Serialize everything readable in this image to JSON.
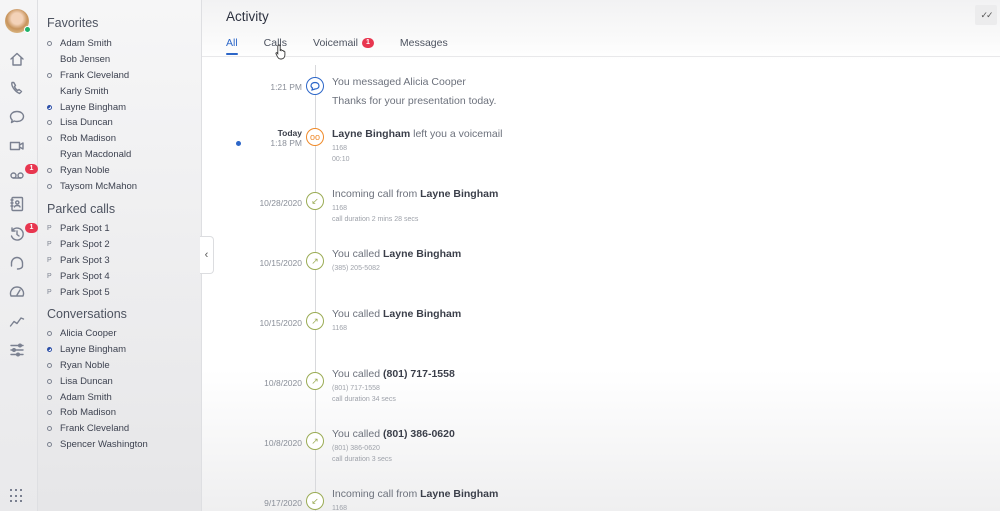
{
  "rail": {
    "badges": {
      "voicemail": "1",
      "history": "1"
    }
  },
  "sidebar": {
    "favorites_title": "Favorites",
    "favorites": [
      {
        "name": "Adam Smith",
        "status": "ring"
      },
      {
        "name": "Bob Jensen",
        "status": "none"
      },
      {
        "name": "Frank Cleveland",
        "status": "ring"
      },
      {
        "name": "Karly Smith",
        "status": "none"
      },
      {
        "name": "Layne Bingham",
        "status": "half"
      },
      {
        "name": "Lisa Duncan",
        "status": "ring"
      },
      {
        "name": "Rob Madison",
        "status": "ring"
      },
      {
        "name": "Ryan Macdonald",
        "status": "none"
      },
      {
        "name": "Ryan Noble",
        "status": "ring"
      },
      {
        "name": "Taysom McMahon",
        "status": "ring"
      }
    ],
    "parked_title": "Parked calls",
    "parked": [
      {
        "name": "Park Spot 1",
        "status": "park"
      },
      {
        "name": "Park Spot 2",
        "status": "park"
      },
      {
        "name": "Park Spot 3",
        "status": "park"
      },
      {
        "name": "Park Spot 4",
        "status": "park"
      },
      {
        "name": "Park Spot 5",
        "status": "park"
      }
    ],
    "park_glyph": "P",
    "conversations_title": "Conversations",
    "conversations": [
      {
        "name": "Alicia Cooper",
        "status": "ring"
      },
      {
        "name": "Layne Bingham",
        "status": "half"
      },
      {
        "name": "Ryan Noble",
        "status": "ring"
      },
      {
        "name": "Lisa Duncan",
        "status": "ring"
      },
      {
        "name": "Adam Smith",
        "status": "ring"
      },
      {
        "name": "Rob Madison",
        "status": "ring"
      },
      {
        "name": "Frank Cleveland",
        "status": "ring"
      },
      {
        "name": "Spencer Washington",
        "status": "ring"
      }
    ]
  },
  "main": {
    "title": "Activity",
    "tabs": [
      {
        "label": "All",
        "active": true
      },
      {
        "label": "Calls",
        "active": false
      },
      {
        "label": "Voicemail",
        "active": false,
        "badge": "1"
      },
      {
        "label": "Messages",
        "active": false
      }
    ],
    "collapse_glyph": "‹",
    "mark_read_glyph": "✓✓",
    "activity": [
      {
        "type": "msg",
        "date": "1:21 PM",
        "date_bold": "",
        "prefix": "You messaged Alicia Cooper",
        "bold": "",
        "suffix": "",
        "body": "Thanks for your presentation today.",
        "details": []
      },
      {
        "type": "vm",
        "date": "1:18 PM",
        "date_bold": "Today",
        "prefix": "",
        "bold": "Layne Bingham",
        "suffix": " left you a voicemail",
        "body": "",
        "details": [
          "1168",
          "00:10"
        ],
        "unread": true
      },
      {
        "type": "in",
        "date": "10/28/2020",
        "date_bold": "",
        "prefix": "Incoming call from ",
        "bold": "Layne Bingham",
        "suffix": "",
        "body": "",
        "details": [
          "1168",
          "call duration 2 mins 28 secs"
        ]
      },
      {
        "type": "out",
        "date": "10/15/2020",
        "date_bold": "",
        "prefix": "You called ",
        "bold": "Layne Bingham",
        "suffix": "",
        "body": "",
        "details": [
          "(385) 205-5082"
        ]
      },
      {
        "type": "out",
        "date": "10/15/2020",
        "date_bold": "",
        "prefix": "You called ",
        "bold": "Layne Bingham",
        "suffix": "",
        "body": "",
        "details": [
          "1168"
        ]
      },
      {
        "type": "out",
        "date": "10/8/2020",
        "date_bold": "",
        "prefix": "You called ",
        "bold": "(801) 717-1558",
        "suffix": "",
        "body": "",
        "details": [
          "(801) 717-1558",
          "call duration 34 secs"
        ]
      },
      {
        "type": "out",
        "date": "10/8/2020",
        "date_bold": "",
        "prefix": "You called ",
        "bold": "(801) 386-0620",
        "suffix": "",
        "body": "",
        "details": [
          "(801) 386-0620",
          "call duration 3 secs"
        ]
      },
      {
        "type": "in",
        "date": "9/17/2020",
        "date_bold": "",
        "prefix": "Incoming call from ",
        "bold": "Layne Bingham",
        "suffix": "",
        "body": "",
        "details": [
          "1168"
        ]
      }
    ]
  }
}
